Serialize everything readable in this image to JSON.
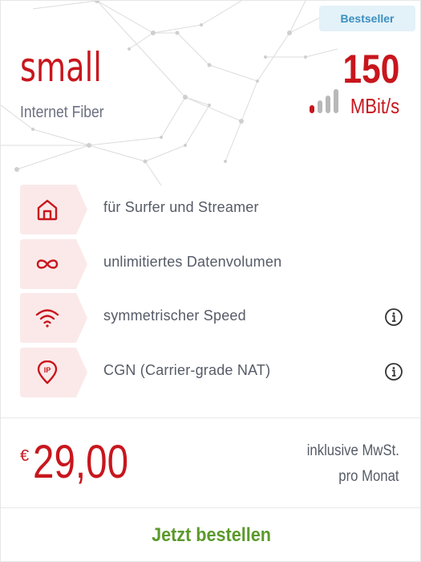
{
  "badge": {
    "label": "Bestseller"
  },
  "plan": {
    "name": "small",
    "subtitle": "Internet Fiber"
  },
  "speed": {
    "value": "150",
    "unit": "MBit/s",
    "signal_level_bars": 1,
    "signal_total_bars": 4
  },
  "features": [
    {
      "label": "für Surfer und Streamer",
      "icon": "home-icon",
      "has_info": false
    },
    {
      "label": "unlimitiertes Datenvolumen",
      "icon": "infinity-icon",
      "has_info": false
    },
    {
      "label": "symmetrischer Speed",
      "icon": "wifi-icon",
      "has_info": true
    },
    {
      "label": "CGN (Carrier-grade NAT)",
      "icon": "ip-pin-icon",
      "has_info": true
    }
  ],
  "price": {
    "currency": "€",
    "amount": "29,00",
    "tax_note": "inklusive MwSt.",
    "period": "pro Monat"
  },
  "cta": {
    "label": "Jetzt bestellen"
  },
  "colors": {
    "accent": "#c8161d",
    "badge_bg": "#e3f1f8",
    "badge_text": "#3a8fc0",
    "feature_bg": "#fbe9e9",
    "cta": "#5c9a2c",
    "muted_bar": "#b8b8b8"
  }
}
